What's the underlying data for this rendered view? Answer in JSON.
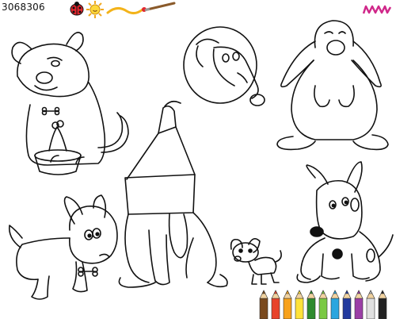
{
  "header": {
    "stock_id": "3068306",
    "ladybug_icon": "ladybug-icon",
    "sun_icon": "sun-icon",
    "brush_icon": "paintbrush-icon",
    "logo_icon": "scribble-logo-icon",
    "logo_color": "#d0288a"
  },
  "illustrations": [
    "sad-dog-with-bowl",
    "dog-face-in-bubble",
    "long-eared-dog-sitting",
    "dog-with-paper-bag",
    "puppy-with-bone",
    "chihuahua",
    "spotted-dog-sitting"
  ],
  "footer": {
    "pencils_icon": "colored-pencils-icon",
    "pencil_colors": [
      "#7a4a1e",
      "#e8432b",
      "#f7a21b",
      "#ffe23a",
      "#2e8b2e",
      "#7ac943",
      "#2aa6df",
      "#233a9e",
      "#9b3fa6",
      "#e0e0e0",
      "#222222"
    ]
  }
}
